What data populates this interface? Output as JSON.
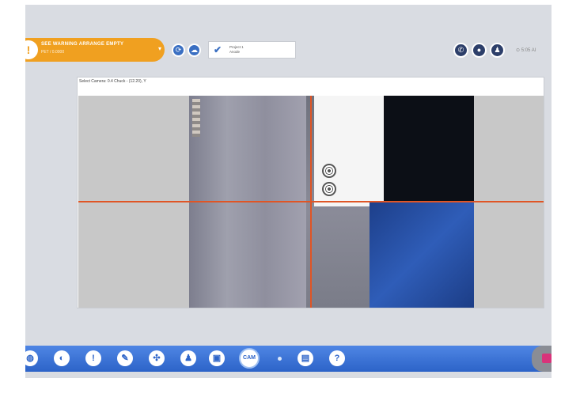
{
  "warning": {
    "badge": "!",
    "title": "SEE WARNING ARRANGE EMPTY",
    "subtitle": "PET / 0.0000",
    "caret": "▾"
  },
  "project": {
    "line1": "Project 1",
    "line2": "Anode"
  },
  "clock": {
    "text": "⊙ 5:05 AI"
  },
  "panel": {
    "title": "Select Camera: 0.4 Chuck - (12.20), Y"
  },
  "toolbar": {
    "cam_label": "CAM"
  },
  "icons": {
    "top_left": [
      "refresh-icon",
      "cloud-icon"
    ],
    "top_right": [
      "phone-icon",
      "chat-icon",
      "user-icon"
    ],
    "toolbar": [
      "globe-icon",
      "layers-icon",
      "alert-icon",
      "wrench-icon",
      "network-icon",
      "user-icon",
      "monitor-icon",
      "cam-icon",
      "dot-icon",
      "grid-icon",
      "help-icon"
    ]
  },
  "colors": {
    "warning": "#f0a020",
    "toolbar": "#2c63c8",
    "crosshair": "#e05525",
    "accent": "#3a6fc2"
  }
}
